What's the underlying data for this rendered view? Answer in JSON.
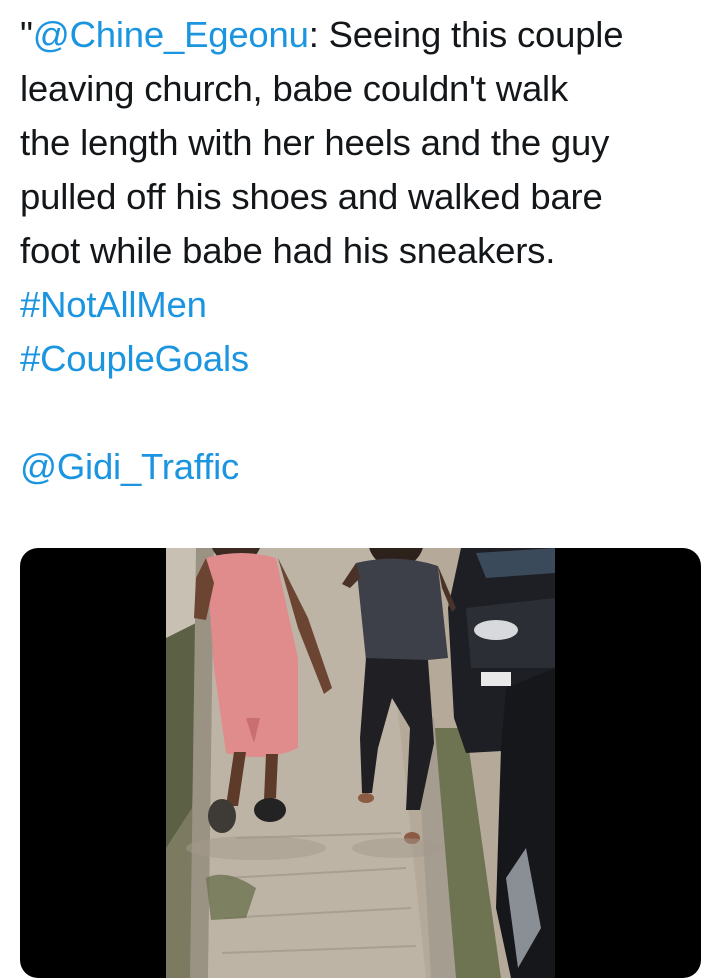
{
  "tweet": {
    "quote_mark": "\"",
    "author_mention": "@Chine_Egeonu",
    "line1_rest": ": Seeing this couple",
    "line2": "leaving church, babe couldn't walk",
    "line3": "the length with her heels and the guy",
    "line4": "pulled off his shoes and walked bare",
    "line5": "foot while babe had his sneakers.",
    "hashtag1": "#NotAllMen",
    "hashtag2": "#CoupleGoals",
    "credit_mention": "@Gidi_Traffic"
  },
  "media": {
    "type": "video",
    "scene": "couple-walking-on-sidewalk"
  },
  "colors": {
    "link": "#1b95e0",
    "text": "#14171a",
    "media_bg": "#000000"
  }
}
